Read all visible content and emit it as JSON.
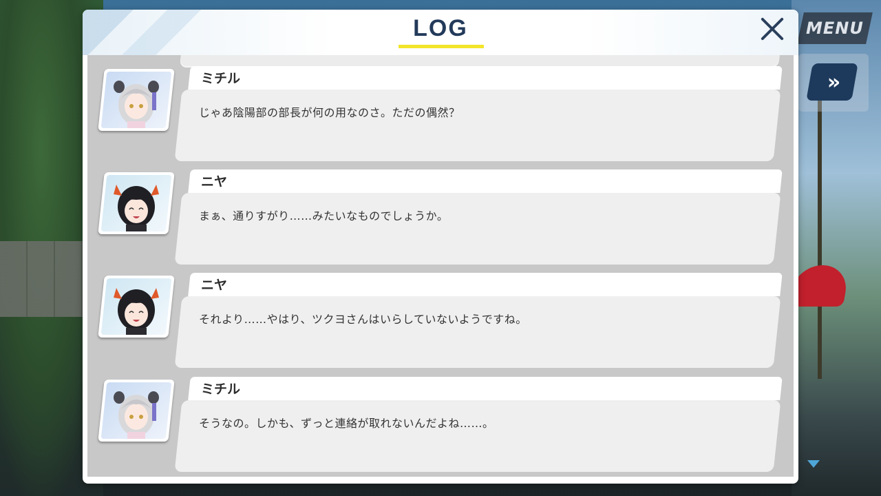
{
  "hud": {
    "menu_label": "MENU",
    "fastforward_glyph": "»"
  },
  "log": {
    "title": "LOG",
    "entries": [
      {
        "speaker": "ミチル",
        "character": "michiru",
        "text": "じゃあ陰陽部の部長が何の用なのさ。ただの偶然？"
      },
      {
        "speaker": "ニヤ",
        "character": "niya",
        "text": "まぁ、通りすがり……みたいなものでしょうか。"
      },
      {
        "speaker": "ニヤ",
        "character": "niya",
        "text": "それより……やはり、ツクヨさんはいらしていないようですね。"
      },
      {
        "speaker": "ミチル",
        "character": "michiru",
        "text": "そうなの。しかも、ずっと連絡が取れないんだよね……。"
      }
    ]
  },
  "colors": {
    "title": "#233a5a",
    "underline": "#f3e52a",
    "fastforward_bg": "#1d3a5c",
    "scroll_indicator": "#4fa6d8"
  }
}
